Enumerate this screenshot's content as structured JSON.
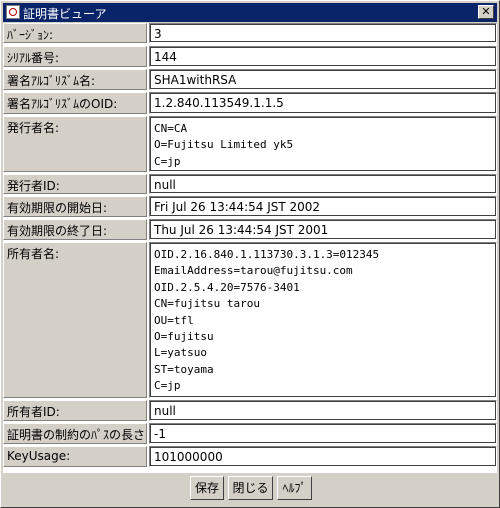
{
  "window": {
    "title": "証明書ビューア",
    "close_glyph": "✕"
  },
  "fields": [
    {
      "label": "ﾊﾞｰｼﾞｮﾝ:",
      "value": "3"
    },
    {
      "label": "ｼﾘｱﾙ番号:",
      "value": "144"
    },
    {
      "label": "署名ｱﾙｺﾞﾘｽﾞﾑ名:",
      "value": "SHA1withRSA"
    },
    {
      "label": "署名ｱﾙｺﾞﾘｽﾞﾑのOID:",
      "value": "1.2.840.113549.1.1.5"
    },
    {
      "label": "発行者名:",
      "lines": [
        "CN=CA",
        "O=Fujitsu Limited yk5",
        "C=jp"
      ]
    },
    {
      "label": "発行者ID:",
      "value": "null"
    },
    {
      "label": "有効期限の開始日:",
      "value": "Fri Jul 26 13:44:54 JST 2002"
    },
    {
      "label": "有効期限の終了日:",
      "value": "Thu Jul 26 13:44:54 JST 2001"
    },
    {
      "label": "所有者名:",
      "lines": [
        "OID.2.16.840.1.113730.3.1.3=012345",
        "EmailAddress=tarou@fujitsu.com",
        "OID.2.5.4.20=7576-3401",
        "CN=fujitsu tarou",
        "OU=tfl",
        "O=fujitsu",
        "L=yatsuo",
        "ST=toyama",
        "C=jp"
      ]
    },
    {
      "label": "所有者ID:",
      "value": "null"
    },
    {
      "label": "証明書の制約のﾊﾟｽの長さ:",
      "value": "-1"
    },
    {
      "label": "KeyUsage:",
      "value": "101000000"
    }
  ],
  "buttons": {
    "save": "保存",
    "close": "閉じる",
    "help": "ﾍﾙﾌﾟ"
  }
}
